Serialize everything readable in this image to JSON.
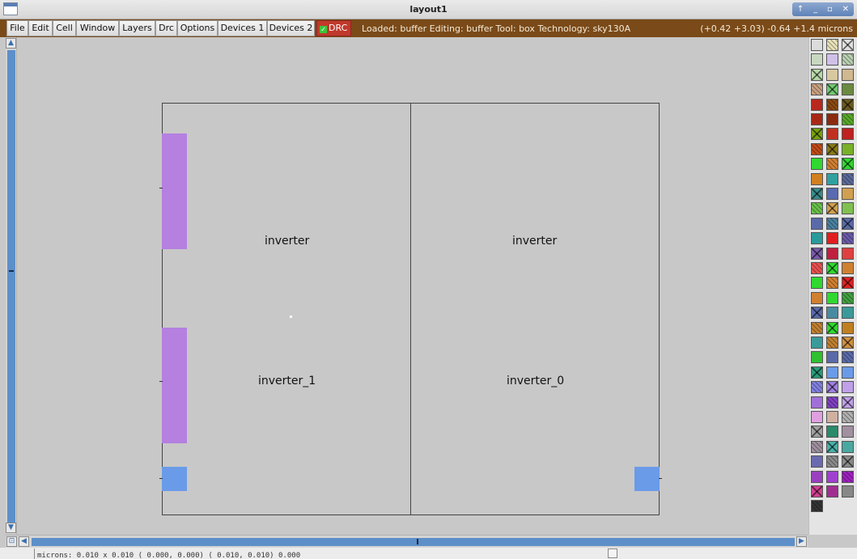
{
  "window": {
    "title": "layout1",
    "controls": [
      "↑",
      "_",
      "▫",
      "✕"
    ]
  },
  "menu": [
    "File",
    "Edit",
    "Cell",
    "Window",
    "Layers",
    "Drc",
    "Options",
    "Devices 1",
    "Devices 2"
  ],
  "drc": {
    "label": "DRC",
    "checked": true,
    "check_color": "#3cc43c",
    "bg_color": "#c0392b"
  },
  "status": {
    "left": "Loaded: buffer Editing: buffer Tool: box  Technology: sky130A",
    "right": "(+0.42 +3.03) -0.64 +1.4 microns"
  },
  "layout": {
    "cells": [
      {
        "name": "inverter"
      },
      {
        "name": "inverter"
      },
      {
        "name": "inverter_1"
      },
      {
        "name": "inverter_0"
      }
    ],
    "layer_colors": {
      "purple": "#b580e0",
      "blue": "#6a9be8"
    }
  },
  "scroll": {
    "up_icon": "up-arrow-icon",
    "down_icon": "down-arrow-icon",
    "left_icon": "left-arrow-icon",
    "right_icon": "right-arrow-icon",
    "zoom_icon": "zoom-box-icon"
  },
  "statusbar": {
    "coords": "microns:   0.010 x 0.010   ( 0.000,  0.000)  ( 0.010,  0.010)  0.000"
  },
  "palette_colors": [
    "#dcdcdc",
    "#e8e0b8",
    "#e0e0e0",
    "#c8d8c0",
    "#d0c0e8",
    "#b8d0b0",
    "#b8d8a8",
    "#d8c8a0",
    "#d0b890",
    "#c8a080",
    "#70c870",
    "#6a8a40",
    "#b8281e",
    "#8a4a10",
    "#6a5a20",
    "#a82818",
    "#8a2a10",
    "#58a828",
    "#78a010",
    "#c03020",
    "#c02020",
    "#c04a18",
    "#887818",
    "#78b028",
    "#30d830",
    "#d08030",
    "#30d830",
    "#d08020",
    "#30a0a0",
    "#5a6a9a",
    "#3a8a8a",
    "#5a6ab0",
    "#d0a050",
    "#68c048",
    "#d0a050",
    "#80c050",
    "#5a6aa8",
    "#4a80a0",
    "#5a6aa8",
    "#2a9a9a",
    "#e02020",
    "#6a5aa8",
    "#7a5aa8",
    "#c02040",
    "#e04040",
    "#e85050",
    "#30d830",
    "#d08030",
    "#30d830",
    "#d08030",
    "#e02020",
    "#d08030",
    "#30d830",
    "#40a040",
    "#5a6aa8",
    "#4a8aa0",
    "#3a9a9a",
    "#c08030",
    "#30d830",
    "#c08020",
    "#3a9a9a",
    "#c08030",
    "#d09040",
    "#30c030",
    "#5a6aa8",
    "#5a6aa8",
    "#2a9a7a",
    "#6a9be8",
    "#6a9be8",
    "#8080e0",
    "#a080e0",
    "#c0a0e8",
    "#a070d8",
    "#8040c0",
    "#c0a0e8",
    "#e0a0e0",
    "#d0b0a0",
    "#b0b0b0",
    "#a0a0a0",
    "#2a8a6a",
    "#a090a0",
    "#a090a0",
    "#4ab0a8",
    "#4aa8a0",
    "#6a6ab0",
    "#8a8a8a",
    "#8a8a8a",
    "#9a40c0",
    "#a040d0",
    "#a020c0",
    "#d04090",
    "#a03090",
    "#888888",
    "#333333"
  ]
}
